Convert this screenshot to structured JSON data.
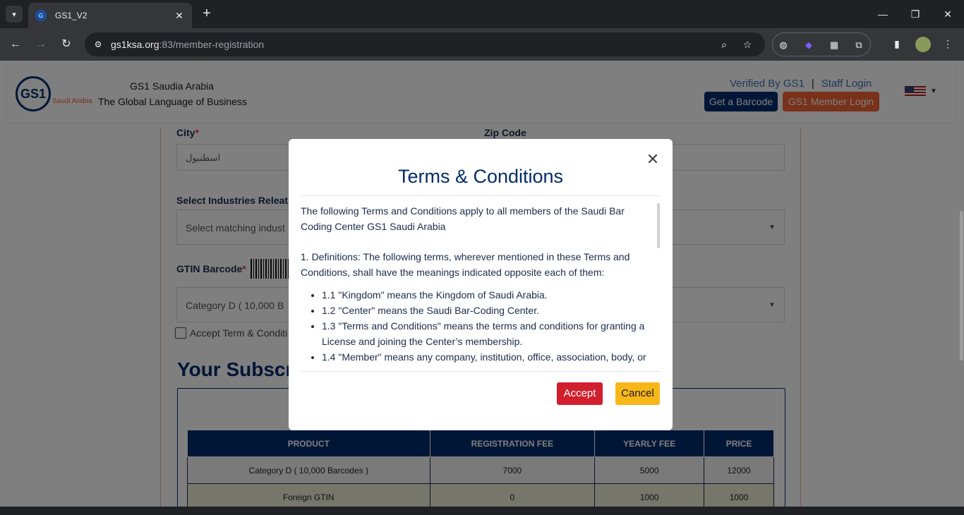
{
  "browser": {
    "tab_title": "GS1_V2",
    "url_host": "gs1ksa.org",
    "url_path": ":83/member-registration"
  },
  "header": {
    "logo_text": "GS1",
    "logo_sub": "Saudi Arabia",
    "brand_name": "GS1 Saudia Arabia",
    "brand_tagline": "The Global Language of Business",
    "verified_link": "Verified By GS1",
    "separator": "|",
    "staff_login": "Staff Login",
    "get_barcode": "Get a Barcode",
    "member_login": "GS1 Member Login"
  },
  "form": {
    "city_label": "City",
    "required_mark": "*",
    "city_value": "اسطنبول",
    "zip_label": "Zip Code",
    "zip_value": "",
    "industries_label": "Select Industries Releat",
    "industries_placeholder": "Select matching indust",
    "gtin_label": "GTIN Barcode",
    "gtin_value": "Category D ( 10,000 B",
    "accept_label": "Accept Term & Conditi",
    "subscription_title": "Your Subscr"
  },
  "table": {
    "headers": [
      "PRODUCT",
      "REGISTRATION FEE",
      "YEARLY FEE",
      "PRICE"
    ],
    "rows": [
      [
        "Category D ( 10,000 Barcodes )",
        "7000",
        "5000",
        "12000"
      ],
      [
        "Foreign GTIN",
        "0",
        "1000",
        "1000"
      ]
    ]
  },
  "modal": {
    "title": "Terms & Conditions",
    "intro": "The following Terms and Conditions apply to all members of the Saudi Bar Coding Center GS1 Saudi Arabia",
    "definitions": "1. Definitions: The following terms, wherever mentioned in these Terms and Conditions, shall have the meanings indicated opposite each of them:",
    "items": [
      "1.1 \"Kingdom\" means the Kingdom of Saudi Arabia.",
      "1.2 \"Center\" means the Saudi Bar-Coding Center.",
      "1.3 \"Terms and Conditions\" means the terms and conditions for granting a License and joining the Center’s membership.",
      "1.4 \"Member\" means any company, institution, office, association, body, or"
    ],
    "accept_button": "Accept",
    "cancel_button": "Cancel"
  },
  "colors": {
    "navy": "#002c6c",
    "orange": "#f26334",
    "accept_red": "#d11f2e",
    "cancel_yellow": "#f7b718"
  }
}
